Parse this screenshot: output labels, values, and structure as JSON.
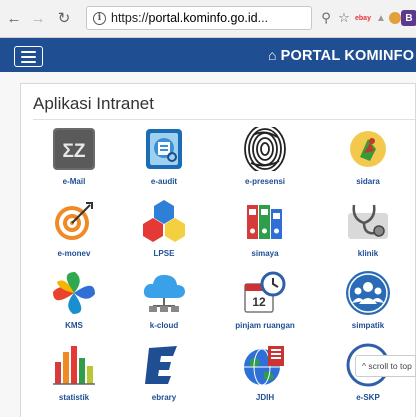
{
  "browser": {
    "url": "https://portal.kominfo.go.id...",
    "url_prefix": "https://",
    "url_host": "portal.kominfo.go.id",
    "url_rest": "...",
    "back_icon": "arrow-left",
    "forward_icon": "arrow-right",
    "reload_icon": "reload",
    "info_glyph": "i",
    "extensions": [
      "bookmark-star",
      "ebay",
      "triangle",
      "cookie",
      "B",
      "menu"
    ],
    "ext_b_label": "B"
  },
  "navbar": {
    "brand_label": "PORTAL KOMINFO",
    "brand_color": "#1f4e93"
  },
  "panel": {
    "title": "Aplikasi Intranet"
  },
  "apps": [
    {
      "label": "e-Mail",
      "icon": "email-ez-icon"
    },
    {
      "label": "e-audit",
      "icon": "audit-icon"
    },
    {
      "label": "e-presensi",
      "icon": "fingerprint-icon"
    },
    {
      "label": "sidara",
      "icon": "sidara-icon"
    },
    {
      "label": "e-monev",
      "icon": "target-icon"
    },
    {
      "label": "LPSE",
      "icon": "hexagons-icon"
    },
    {
      "label": "simaya",
      "icon": "binders-icon"
    },
    {
      "label": "klinik",
      "icon": "stethoscope-icon"
    },
    {
      "label": "KMS",
      "icon": "pinwheel-icon"
    },
    {
      "label": "k-cloud",
      "icon": "cloud-icon"
    },
    {
      "label": "pinjam ruangan",
      "icon": "calendar-clock-icon"
    },
    {
      "label": "simpatik",
      "icon": "people-icon"
    },
    {
      "label": "statistik",
      "icon": "bar-chart-icon"
    },
    {
      "label": "ebrary",
      "icon": "ebrary-icon"
    },
    {
      "label": "JDIH",
      "icon": "globe-icon"
    },
    {
      "label": "e-SKP",
      "icon": "skp-icon"
    }
  ],
  "scroll_top": {
    "label": "^ scroll to top"
  }
}
